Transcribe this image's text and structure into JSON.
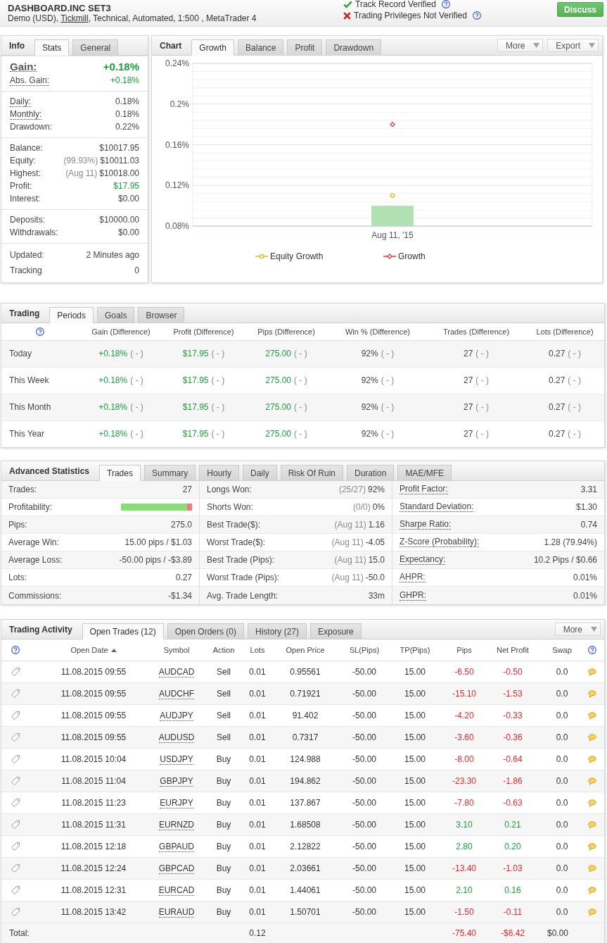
{
  "header": {
    "title": "DASHBOARD.INC SET3",
    "details_start": "Demo (USD), ",
    "broker": "Tickmill",
    "details_end": ", Technical, Automated, 1:500 , MetaTrader 4",
    "verifications": [
      {
        "label": "Track Record Verified",
        "verified": true
      },
      {
        "label": "Trading Privileges Not Verified",
        "verified": false
      }
    ],
    "button": "Discuss"
  },
  "info": {
    "title": "Info",
    "tabs": [
      {
        "label": "Stats",
        "selected": true
      },
      {
        "label": "General",
        "selected": false
      }
    ],
    "groups": [
      {
        "rows": [
          {
            "kind": "headline",
            "label": "Gain:",
            "value": "+0.18%",
            "positive": true,
            "dotted": true
          },
          {
            "kind": "plain",
            "label": "Abs. Gain:",
            "value": "+0.18%",
            "positive": true,
            "dotted": true
          }
        ]
      },
      {
        "rows": [
          {
            "kind": "plain",
            "label": "Daily:",
            "value": "0.18%",
            "positive": false,
            "dotted": true
          },
          {
            "kind": "plain",
            "label": "Monthly:",
            "value": "0.18%",
            "positive": false,
            "dotted": true
          },
          {
            "kind": "plain",
            "label": "Drawdown:",
            "value": "0.22%",
            "positive": false,
            "dotted": false
          }
        ]
      },
      {
        "rows": [
          {
            "kind": "plain",
            "label": "Balance:",
            "value": "$10017.95",
            "positive": false,
            "dotted": false
          },
          {
            "kind": "plain",
            "label": "Equity:",
            "note": "(99.93%)",
            "value": "$10011.03",
            "positive": false,
            "dotted": false
          },
          {
            "kind": "plain",
            "label": "Highest:",
            "note": "(Aug 11)",
            "value": "$10018.00",
            "positive": false,
            "dotted": false
          },
          {
            "kind": "plain",
            "label": "Profit:",
            "value": "$17.95",
            "positive": true,
            "dotted": false
          },
          {
            "kind": "plain",
            "label": "Interest:",
            "value": "$0.00",
            "positive": false,
            "dotted": false
          }
        ]
      },
      {
        "rows": [
          {
            "kind": "plain",
            "label": "Deposits:",
            "value": "$10000.00",
            "positive": false,
            "dotted": false
          },
          {
            "kind": "plain",
            "label": "Withdrawals:",
            "value": "$0.00",
            "positive": false,
            "dotted": false
          }
        ]
      },
      {
        "rows": [
          {
            "kind": "plain",
            "label": "Updated:",
            "value": "2 Minutes ago",
            "positive": false,
            "dotted": false
          },
          {
            "kind": "plain",
            "label": "Tracking",
            "value": "0",
            "positive": false,
            "dotted": false
          }
        ]
      }
    ]
  },
  "chart": {
    "title": "Chart",
    "tabs": [
      {
        "label": "Growth",
        "selected": true
      },
      {
        "label": "Balance",
        "selected": false
      },
      {
        "label": "Profit",
        "selected": false
      },
      {
        "label": "Drawdown",
        "selected": false
      }
    ],
    "menus": [
      "More",
      "Export"
    ],
    "chart_data": {
      "type": "line",
      "categories": [
        "Aug 11, '15"
      ],
      "series": [
        {
          "name": "Equity Growth",
          "color": "#f2b705",
          "marker": "circle",
          "values": [
            0.11
          ]
        },
        {
          "name": "Growth",
          "color": "#e53935",
          "marker": "diamond",
          "values": [
            0.18
          ]
        },
        {
          "type": "bar",
          "color": "#b3e0b3",
          "values": [
            0.1
          ]
        }
      ],
      "ylim": [
        0.08,
        0.24
      ],
      "yticks": [
        {
          "value": 0.08,
          "label": "0.08%"
        },
        {
          "value": 0.12,
          "label": "0.12%"
        },
        {
          "value": 0.16,
          "label": "0.16%"
        },
        {
          "value": 0.2,
          "label": "0.2%"
        },
        {
          "value": 0.24,
          "label": "0.24%"
        }
      ],
      "grid": true,
      "legend": "bottom"
    }
  },
  "trading": {
    "title": "Trading",
    "tabs": [
      {
        "label": "Periods",
        "selected": true
      },
      {
        "label": "Goals",
        "selected": false
      },
      {
        "label": "Browser",
        "selected": false
      }
    ],
    "columns": [
      {
        "kind": "help"
      },
      {
        "kind": "text",
        "label": "Gain (Difference)"
      },
      {
        "kind": "text",
        "label": "Profit (Difference)"
      },
      {
        "kind": "text",
        "label": "Pips (Difference)"
      },
      {
        "kind": "text",
        "label": "Win % (Difference)"
      },
      {
        "kind": "text",
        "label": "Trades (Difference)"
      },
      {
        "kind": "text",
        "label": "Lots (Difference)"
      }
    ],
    "rows": [
      {
        "cells": [
          {
            "kind": "period",
            "value": "Today"
          },
          {
            "kind": "figure",
            "value": "+0.18%",
            "diff": "( - )",
            "positive": true
          },
          {
            "kind": "figure",
            "value": "$17.95",
            "diff": "( - )",
            "positive": true
          },
          {
            "kind": "figure",
            "value": "275.00",
            "diff": "( - )",
            "positive": true
          },
          {
            "kind": "figure",
            "value": "92%",
            "diff": "( - )",
            "positive": false
          },
          {
            "kind": "figure",
            "value": "27",
            "diff": "( - )",
            "positive": false
          },
          {
            "kind": "figure",
            "value": "0.27",
            "diff": "( - )",
            "positive": false
          }
        ]
      },
      {
        "cells": [
          {
            "kind": "period",
            "value": "This Week"
          },
          {
            "kind": "figure",
            "value": "+0.18%",
            "diff": "( - )",
            "positive": true
          },
          {
            "kind": "figure",
            "value": "$17.95",
            "diff": "( - )",
            "positive": true
          },
          {
            "kind": "figure",
            "value": "275.00",
            "diff": "( - )",
            "positive": true
          },
          {
            "kind": "figure",
            "value": "92%",
            "diff": "( - )",
            "positive": false
          },
          {
            "kind": "figure",
            "value": "27",
            "diff": "( - )",
            "positive": false
          },
          {
            "kind": "figure",
            "value": "0.27",
            "diff": "( - )",
            "positive": false
          }
        ]
      },
      {
        "cells": [
          {
            "kind": "period",
            "value": "This Month"
          },
          {
            "kind": "figure",
            "value": "+0.18%",
            "diff": "( - )",
            "positive": true
          },
          {
            "kind": "figure",
            "value": "$17.95",
            "diff": "( - )",
            "positive": true
          },
          {
            "kind": "figure",
            "value": "275.00",
            "diff": "( - )",
            "positive": true
          },
          {
            "kind": "figure",
            "value": "92%",
            "diff": "( - )",
            "positive": false
          },
          {
            "kind": "figure",
            "value": "27",
            "diff": "( - )",
            "positive": false
          },
          {
            "kind": "figure",
            "value": "0.27",
            "diff": "( - )",
            "positive": false
          }
        ]
      },
      {
        "cells": [
          {
            "kind": "period",
            "value": "This Year"
          },
          {
            "kind": "figure",
            "value": "+0.18%",
            "diff": "( - )",
            "positive": true
          },
          {
            "kind": "figure",
            "value": "$17.95",
            "diff": "( - )",
            "positive": true
          },
          {
            "kind": "figure",
            "value": "275.00",
            "diff": "( - )",
            "positive": true
          },
          {
            "kind": "figure",
            "value": "92%",
            "diff": "( - )",
            "positive": false
          },
          {
            "kind": "figure",
            "value": "27",
            "diff": "( - )",
            "positive": false
          },
          {
            "kind": "figure",
            "value": "0.27",
            "diff": "( - )",
            "positive": false
          }
        ]
      }
    ]
  },
  "advanced_statistics": {
    "title": "Advanced Statistics",
    "tabs": [
      {
        "label": "Trades",
        "selected": true
      },
      {
        "label": "Summary",
        "selected": false
      },
      {
        "label": "Hourly",
        "selected": false
      },
      {
        "label": "Daily",
        "selected": false
      },
      {
        "label": "Risk Of Ruin",
        "selected": false
      },
      {
        "label": "Duration",
        "selected": false
      },
      {
        "label": "MAE/MFE",
        "selected": false
      }
    ],
    "columns": [
      {
        "dotted_labels": false,
        "rows": [
          {
            "kind": "text",
            "label": "Trades:",
            "value": "27"
          },
          {
            "kind": "bar",
            "label": "Profitability:",
            "level": 0.93
          },
          {
            "kind": "text",
            "label": "Pips:",
            "value": "275.0"
          },
          {
            "kind": "text",
            "label": "Average Win:",
            "value": "15.00 pips / $1.03"
          },
          {
            "kind": "text",
            "label": "Average Loss:",
            "value": "-50.00 pips / -$3.89"
          },
          {
            "kind": "text",
            "label": "Lots:",
            "value": "0.27"
          },
          {
            "kind": "text",
            "label": "Commissions:",
            "value": "-$1.34"
          }
        ]
      },
      {
        "dotted_labels": false,
        "rows": [
          {
            "kind": "text",
            "label": "Longs Won:",
            "note": "(25/27)",
            "value": "92%"
          },
          {
            "kind": "text",
            "label": "Shorts Won:",
            "note": "(0/0)",
            "value": "0%"
          },
          {
            "kind": "text",
            "label": "Best Trade($):",
            "note": "(Aug 11)",
            "value": "1.16"
          },
          {
            "kind": "text",
            "label": "Worst Trade($):",
            "note": "(Aug 11)",
            "value": "-4.05"
          },
          {
            "kind": "text",
            "label": "Best Trade (Pips):",
            "note": "(Aug 11)",
            "value": "15.0"
          },
          {
            "kind": "text",
            "label": "Worst Trade (Pips):",
            "note": "(Aug 11)",
            "value": "-50.0"
          },
          {
            "kind": "text",
            "label": "Avg. Trade Length:",
            "value": "33m"
          }
        ]
      },
      {
        "dotted_labels": true,
        "rows": [
          {
            "kind": "text",
            "label": "Profit Factor:",
            "value": "3.31"
          },
          {
            "kind": "text",
            "label": "Standard Deviation:",
            "value": "$1.30"
          },
          {
            "kind": "text",
            "label": "Sharpe Ratio:",
            "value": "0.74"
          },
          {
            "kind": "text",
            "label": "Z-Score (Probability):",
            "value": "1.28 (79.94%)"
          },
          {
            "kind": "text",
            "label": "Expectancy:",
            "value": "10.2 Pips / $0.66"
          },
          {
            "kind": "text",
            "label": "AHPR:",
            "value": "0.01%"
          },
          {
            "kind": "text",
            "label": "GHPR:",
            "value": "0.01%"
          }
        ]
      }
    ]
  },
  "trading_activity": {
    "title": "Trading Activity",
    "tabs": [
      {
        "label": "Open Trades (12)",
        "selected": true
      },
      {
        "label": "Open Orders (0)",
        "selected": false
      },
      {
        "label": "History (27)",
        "selected": false
      },
      {
        "label": "Exposure",
        "selected": false
      }
    ],
    "menu": "More",
    "columns": [
      {
        "kind": "help"
      },
      {
        "kind": "text",
        "label": "Open Date",
        "sorted": true
      },
      {
        "kind": "text",
        "label": "Symbol",
        "sorted": false
      },
      {
        "kind": "text",
        "label": "Action",
        "sorted": false
      },
      {
        "kind": "text",
        "label": "Lots",
        "sorted": false
      },
      {
        "kind": "text",
        "label": "Open Price",
        "sorted": false
      },
      {
        "kind": "text",
        "label": "SL(Pips)",
        "sorted": false
      },
      {
        "kind": "text",
        "label": "TP(Pips)",
        "sorted": false
      },
      {
        "kind": "text",
        "label": "Pips",
        "sorted": false
      },
      {
        "kind": "text",
        "label": "Net Profit",
        "sorted": false
      },
      {
        "kind": "text",
        "label": "Swap",
        "sorted": false
      },
      {
        "kind": "help"
      }
    ],
    "rows": [
      {
        "date": "11.08.2015 09:55",
        "symbol": "AUDCAD",
        "action": "Sell",
        "lots": "0.01",
        "open_price": "0.95561",
        "sl": "-50.00",
        "tp": "15.00",
        "pips": "-6.50",
        "net_profit": "-0.50",
        "swap": "0.0",
        "winning": false
      },
      {
        "date": "11.08.2015 09:55",
        "symbol": "AUDCHF",
        "action": "Sell",
        "lots": "0.01",
        "open_price": "0.71921",
        "sl": "-50.00",
        "tp": "15.00",
        "pips": "-15.10",
        "net_profit": "-1.53",
        "swap": "0.0",
        "winning": false
      },
      {
        "date": "11.08.2015 09:55",
        "symbol": "AUDJPY",
        "action": "Sell",
        "lots": "0.01",
        "open_price": "91.402",
        "sl": "-50.00",
        "tp": "15.00",
        "pips": "-4.20",
        "net_profit": "-0.33",
        "swap": "0.0",
        "winning": false
      },
      {
        "date": "11.08.2015 09:55",
        "symbol": "AUDUSD",
        "action": "Sell",
        "lots": "0.01",
        "open_price": "0.7317",
        "sl": "-50.00",
        "tp": "15.00",
        "pips": "-3.60",
        "net_profit": "-0.36",
        "swap": "0.0",
        "winning": false
      },
      {
        "date": "11.08.2015 10:04",
        "symbol": "USDJPY",
        "action": "Buy",
        "lots": "0.01",
        "open_price": "124.988",
        "sl": "-50.00",
        "tp": "15.00",
        "pips": "-8.00",
        "net_profit": "-0.64",
        "swap": "0.0",
        "winning": false
      },
      {
        "date": "11.08.2015 11:04",
        "symbol": "GBPJPY",
        "action": "Buy",
        "lots": "0.01",
        "open_price": "194.862",
        "sl": "-50.00",
        "tp": "15.00",
        "pips": "-23.30",
        "net_profit": "-1.86",
        "swap": "0.0",
        "winning": false
      },
      {
        "date": "11.08.2015 11:23",
        "symbol": "EURJPY",
        "action": "Buy",
        "lots": "0.01",
        "open_price": "137.867",
        "sl": "-50.00",
        "tp": "15.00",
        "pips": "-7.80",
        "net_profit": "-0.63",
        "swap": "0.0",
        "winning": false
      },
      {
        "date": "11.08.2015 11:31",
        "symbol": "EURNZD",
        "action": "Buy",
        "lots": "0.01",
        "open_price": "1.68508",
        "sl": "-50.00",
        "tp": "15.00",
        "pips": "3.10",
        "net_profit": "0.21",
        "swap": "0.0",
        "winning": true
      },
      {
        "date": "11.08.2015 12:18",
        "symbol": "GBPAUD",
        "action": "Buy",
        "lots": "0.01",
        "open_price": "2.12822",
        "sl": "-50.00",
        "tp": "15.00",
        "pips": "2.80",
        "net_profit": "0.20",
        "swap": "0.0",
        "winning": true
      },
      {
        "date": "11.08.2015 12:24",
        "symbol": "GBPCAD",
        "action": "Buy",
        "lots": "0.01",
        "open_price": "2.03661",
        "sl": "-50.00",
        "tp": "15.00",
        "pips": "-13.40",
        "net_profit": "-1.03",
        "swap": "0.0",
        "winning": false
      },
      {
        "date": "11.08.2015 12:31",
        "symbol": "EURCAD",
        "action": "Buy",
        "lots": "0.01",
        "open_price": "1.44061",
        "sl": "-50.00",
        "tp": "15.00",
        "pips": "2.10",
        "net_profit": "0.16",
        "swap": "0.0",
        "winning": true
      },
      {
        "date": "11.08.2015 13:42",
        "symbol": "EURAUD",
        "action": "Buy",
        "lots": "0.01",
        "open_price": "1.50701",
        "sl": "-50.00",
        "tp": "15.00",
        "pips": "-1.50",
        "net_profit": "-0.11",
        "swap": "0.0",
        "winning": false
      }
    ],
    "total": {
      "label": "Total:",
      "lots": "0.12",
      "pips": "-75.40",
      "net_profit": "-$6.42",
      "swap": "$0.00",
      "winning": false
    }
  }
}
